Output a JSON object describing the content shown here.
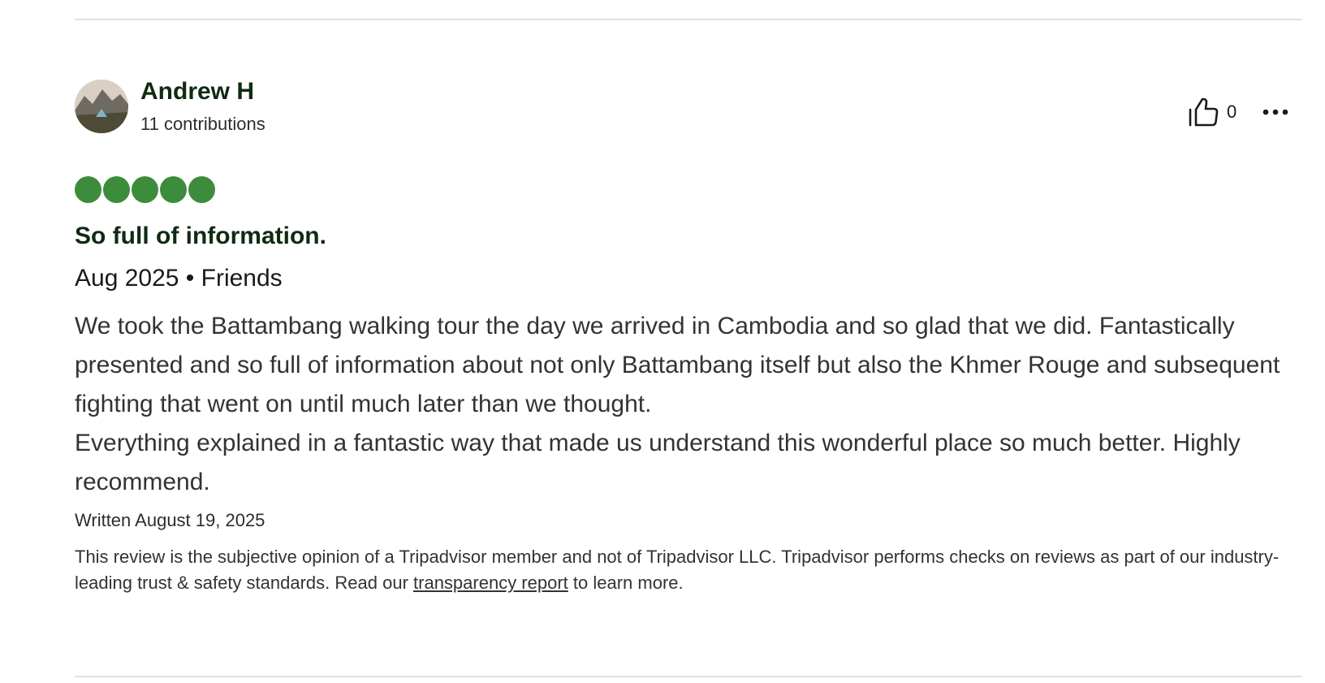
{
  "reviewer": {
    "name": "Andrew H",
    "contributions": "11 contributions",
    "avatar_icon": "avatar-photo"
  },
  "actions": {
    "helpful_icon": "thumbs-up-icon",
    "helpful_count": "0",
    "more_icon": "more-options-icon"
  },
  "rating": {
    "value": 5,
    "max": 5,
    "color": "#3c8c3c"
  },
  "review": {
    "title": "So full of information.",
    "trip_meta": "Aug 2025 • Friends",
    "paragraphs": [
      "We took the Battambang walking tour the day we arrived in Cambodia and so glad that we did. Fantastically presented and so full of information about not only Battambang itself but also the Khmer Rouge and subsequent fighting that went on until much later than we thought.",
      "Everything explained in a fantastic way that made us understand this wonderful place so much better. Highly recommend."
    ],
    "written": "Written August 19, 2025"
  },
  "disclaimer": {
    "text_before": "This review is the subjective opinion of a Tripadvisor member and not of Tripadvisor LLC. Tripadvisor performs checks on reviews as part of our industry-leading trust & safety standards. Read our ",
    "link_text": "transparency report",
    "text_after": " to learn more."
  }
}
